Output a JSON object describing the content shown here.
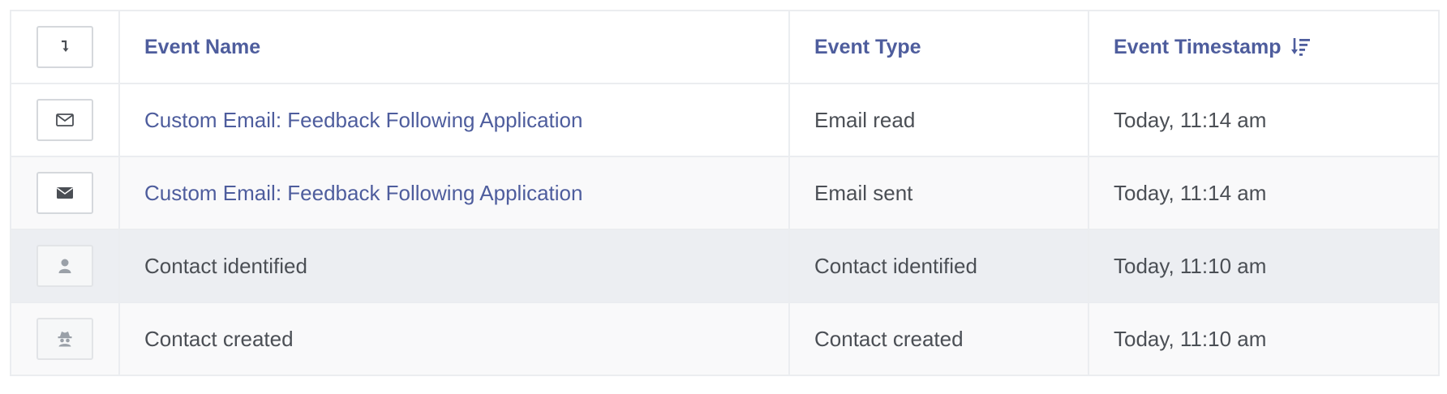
{
  "table": {
    "headers": {
      "toggle_icon": "arrow-down-right-icon",
      "event_name": "Event Name",
      "event_type": "Event Type",
      "event_timestamp": "Event Timestamp",
      "sort_icon": "sort-descending-icon"
    },
    "rows": [
      {
        "icon": "envelope-open-icon",
        "event_name": "Custom Email: Feedback Following Application",
        "event_type": "Email read",
        "event_timestamp": "Today, 11:14 am",
        "is_link": true
      },
      {
        "icon": "envelope-filled-icon",
        "event_name": "Custom Email: Feedback Following Application",
        "event_type": "Email sent",
        "event_timestamp": "Today, 11:14 am",
        "is_link": true
      },
      {
        "icon": "user-icon",
        "event_name": "Contact identified",
        "event_type": "Contact identified",
        "event_timestamp": "Today, 11:10 am",
        "is_link": false
      },
      {
        "icon": "spy-icon",
        "event_name": "Contact created",
        "event_type": "Contact created",
        "event_timestamp": "Today, 11:10 am",
        "is_link": false
      }
    ]
  },
  "colors": {
    "link": "#4e5d9d",
    "text": "#4b4f55",
    "border": "#ebedf0",
    "row_hover": "#eceef2"
  }
}
